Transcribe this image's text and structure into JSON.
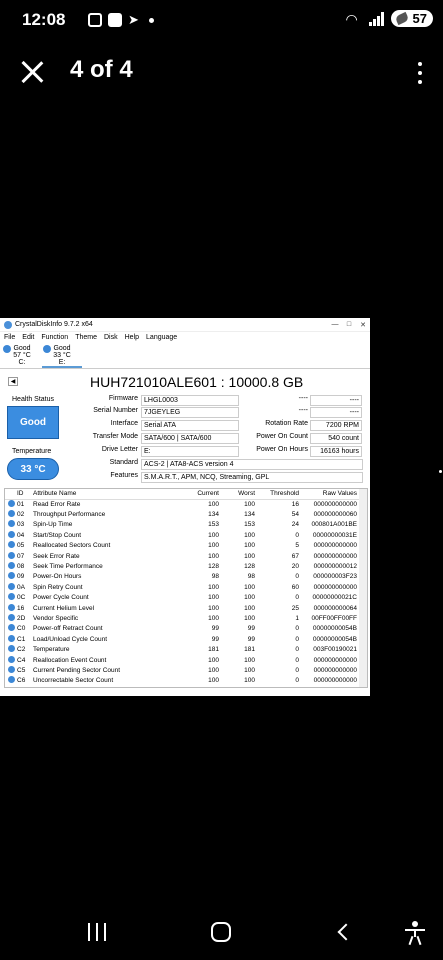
{
  "status_bar": {
    "time": "12:08",
    "battery": "57"
  },
  "header": {
    "page_counter": "4 of 4"
  },
  "app": {
    "window_title": "CrystalDiskInfo 9.7.2 x64",
    "menu": [
      "File",
      "Edit",
      "Function",
      "Theme",
      "Disk",
      "Help",
      "Language"
    ],
    "disks": [
      {
        "status": "Good",
        "temp": "57 °C",
        "letter": "C:"
      },
      {
        "status": "Good",
        "temp": "33 °C",
        "letter": "E:"
      }
    ],
    "model": "HUH721010ALE601 : 10000.8 GB",
    "health_label": "Health Status",
    "health_value": "Good",
    "temp_label": "Temperature",
    "temp_value": "33 °C",
    "info": {
      "firmware_label": "Firmware",
      "firmware": "LHGL0003",
      "serial_label": "Serial Number",
      "serial": "7JGEYLEG",
      "interface_label": "Interface",
      "interface": "Serial ATA",
      "transfer_label": "Transfer Mode",
      "transfer": "SATA/600 | SATA/600",
      "drive_letter_label": "Drive Letter",
      "drive_letter": "E:",
      "standard_label": "Standard",
      "standard": "ACS-2 | ATA8-ACS version 4",
      "features_label": "Features",
      "features": "S.M.A.R.T., APM, NCQ, Streaming, GPL",
      "r1_label": "----",
      "r1": "----",
      "r2_label": "----",
      "r2": "----",
      "rotation_label": "Rotation Rate",
      "rotation": "7200 RPM",
      "power_count_label": "Power On Count",
      "power_count": "540 count",
      "power_hours_label": "Power On Hours",
      "power_hours": "16163 hours"
    },
    "table": {
      "headers": [
        "ID",
        "Attribute Name",
        "Current",
        "Worst",
        "Threshold",
        "Raw Values"
      ],
      "rows": [
        [
          "01",
          "Read Error Rate",
          "100",
          "100",
          "16",
          "000000000000"
        ],
        [
          "02",
          "Throughput Performance",
          "134",
          "134",
          "54",
          "000000000060"
        ],
        [
          "03",
          "Spin-Up Time",
          "153",
          "153",
          "24",
          "000801A001BE"
        ],
        [
          "04",
          "Start/Stop Count",
          "100",
          "100",
          "0",
          "00000000031E"
        ],
        [
          "05",
          "Reallocated Sectors Count",
          "100",
          "100",
          "5",
          "000000000000"
        ],
        [
          "07",
          "Seek Error Rate",
          "100",
          "100",
          "67",
          "000000000000"
        ],
        [
          "08",
          "Seek Time Performance",
          "128",
          "128",
          "20",
          "000000000012"
        ],
        [
          "09",
          "Power-On Hours",
          "98",
          "98",
          "0",
          "000000003F23"
        ],
        [
          "0A",
          "Spin Retry Count",
          "100",
          "100",
          "60",
          "000000000000"
        ],
        [
          "0C",
          "Power Cycle Count",
          "100",
          "100",
          "0",
          "00000000021C"
        ],
        [
          "16",
          "Current Helium Level",
          "100",
          "100",
          "25",
          "000000000064"
        ],
        [
          "2D",
          "Vendor Specific",
          "100",
          "100",
          "1",
          "00FF00FF00FF"
        ],
        [
          "C0",
          "Power-off Retract Count",
          "99",
          "99",
          "0",
          "00000000054B"
        ],
        [
          "C1",
          "Load/Unload Cycle Count",
          "99",
          "99",
          "0",
          "00000000054B"
        ],
        [
          "C2",
          "Temperature",
          "181",
          "181",
          "0",
          "003F00190021"
        ],
        [
          "C4",
          "Reallocation Event Count",
          "100",
          "100",
          "0",
          "000000000000"
        ],
        [
          "C5",
          "Current Pending Sector Count",
          "100",
          "100",
          "0",
          "000000000000"
        ],
        [
          "C6",
          "Uncorrectable Sector Count",
          "100",
          "100",
          "0",
          "000000000000"
        ]
      ]
    }
  }
}
